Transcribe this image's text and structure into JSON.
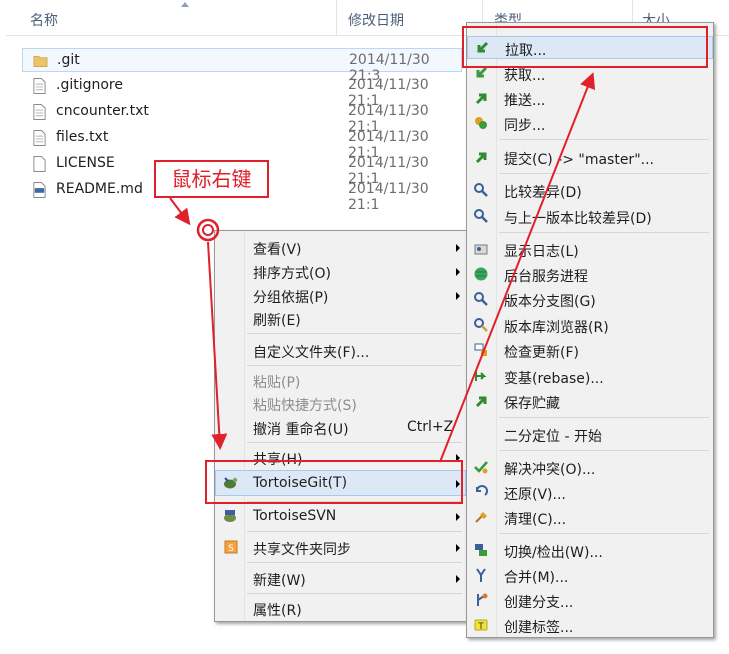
{
  "columns": {
    "name": "名称",
    "date_modified": "修改日期",
    "type": "类型",
    "size": "大小"
  },
  "files": [
    {
      "name": ".git",
      "date": "2014/11/30 21:3",
      "icon": "folder-icon"
    },
    {
      "name": ".gitignore",
      "date": "2014/11/30 21:1",
      "icon": "text-file-icon"
    },
    {
      "name": "cncounter.txt",
      "date": "2014/11/30 21:1",
      "icon": "text-file-icon"
    },
    {
      "name": "files.txt",
      "date": "2014/11/30 21:1",
      "icon": "text-file-icon"
    },
    {
      "name": "LICENSE",
      "date": "2014/11/30 21:1",
      "icon": "blank-file-icon"
    },
    {
      "name": "README.md",
      "date": "2014/11/30 21:1",
      "icon": "markdown-file-icon"
    }
  ],
  "annotation": {
    "right_click_label": "鼠标右键",
    "color": "#e0202a"
  },
  "context_menu": {
    "view": "查看(V)",
    "sort_by": "排序方式(O)",
    "group_by": "分组依据(P)",
    "refresh": "刷新(E)",
    "customize_folder": "自定义文件夹(F)...",
    "paste": "粘贴(P)",
    "paste_shortcut": "粘贴快捷方式(S)",
    "undo_rename": "撤消 重命名(U)",
    "undo_shortcut": "Ctrl+Z",
    "share_with": "共享(H)",
    "tortoisegit": "TortoiseGit(T)",
    "tortoisesvn": "TortoiseSVN",
    "shared_folder_sync": "共享文件夹同步",
    "new": "新建(W)",
    "properties": "属性(R)"
  },
  "git_submenu": {
    "pull": "拉取...",
    "fetch": "获取...",
    "push": "推送...",
    "sync": "同步...",
    "commit": "提交(C) -> \"master\"...",
    "diff": "比较差异(D)",
    "diff_previous": "与上一版本比较差异(D)",
    "show_log": "显示日志(L)",
    "daemon": "后台服务进程",
    "revision_graph": "版本分支图(G)",
    "repo_browser": "版本库浏览器(R)",
    "check_modifications": "检查更新(F)",
    "rebase": "变基(rebase)...",
    "stash_save": "保存贮藏",
    "bisect_start": "二分定位 - 开始",
    "resolve": "解决冲突(O)...",
    "revert": "还原(V)...",
    "clean_up": "清理(C)...",
    "switch_checkout": "切换/检出(W)...",
    "merge": "合并(M)...",
    "create_branch": "创建分支...",
    "create_tag": "创建标签..."
  },
  "colors": {
    "highlight_bg": "#dce8f6",
    "menu_bg": "#f1f1f1",
    "annotation_red": "#e0202a"
  }
}
